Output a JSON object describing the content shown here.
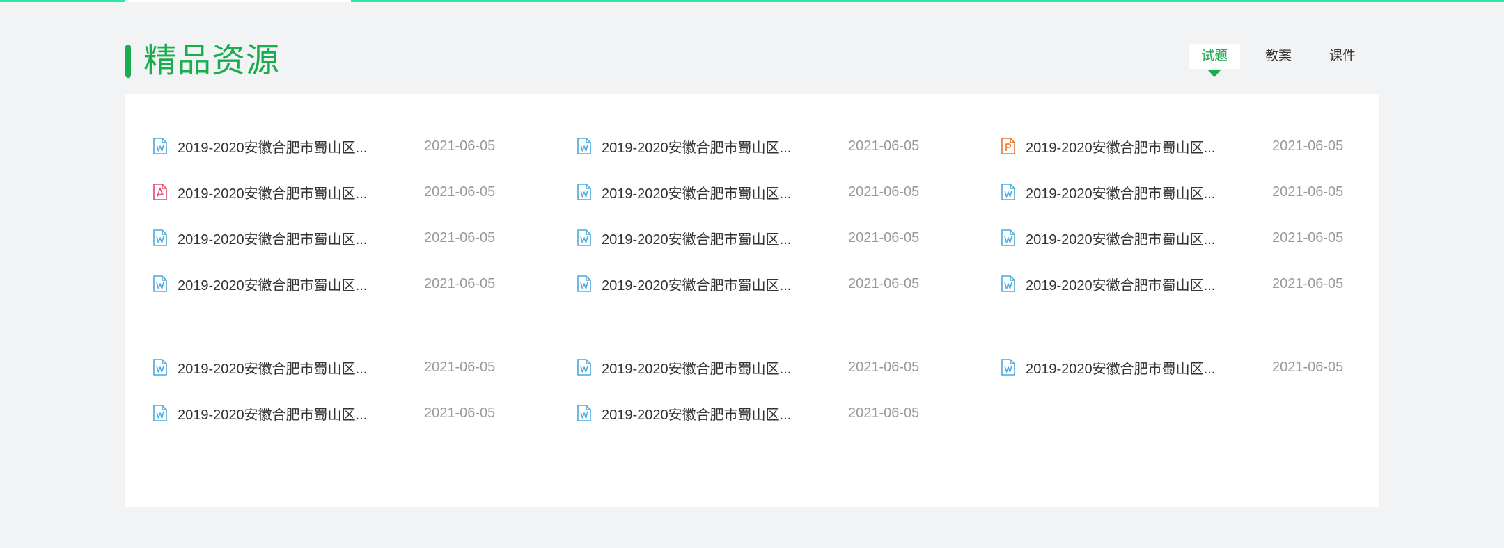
{
  "section": {
    "title": "精品资源"
  },
  "tabs": [
    {
      "label": "试题",
      "active": true
    },
    {
      "label": "教案",
      "active": false
    },
    {
      "label": "课件",
      "active": false
    }
  ],
  "colors": {
    "brand_green": "#1aad4e",
    "top_bar": "#2ee6a5",
    "word_icon": "#4aa8dd",
    "pdf_icon": "#e8476a",
    "ppt_icon": "#e8772e"
  },
  "resources": {
    "group1": [
      {
        "title": "2019-2020安徽合肥市蜀山区...",
        "date": "2021-06-05",
        "icon": "word-file-icon"
      },
      {
        "title": "2019-2020安徽合肥市蜀山区...",
        "date": "2021-06-05",
        "icon": "word-file-icon"
      },
      {
        "title": "2019-2020安徽合肥市蜀山区...",
        "date": "2021-06-05",
        "icon": "ppt-file-icon"
      },
      {
        "title": "2019-2020安徽合肥市蜀山区...",
        "date": "2021-06-05",
        "icon": "pdf-file-icon"
      },
      {
        "title": "2019-2020安徽合肥市蜀山区...",
        "date": "2021-06-05",
        "icon": "word-file-icon"
      },
      {
        "title": "2019-2020安徽合肥市蜀山区...",
        "date": "2021-06-05",
        "icon": "word-file-icon"
      },
      {
        "title": "2019-2020安徽合肥市蜀山区...",
        "date": "2021-06-05",
        "icon": "word-file-icon"
      },
      {
        "title": "2019-2020安徽合肥市蜀山区...",
        "date": "2021-06-05",
        "icon": "word-file-icon"
      },
      {
        "title": "2019-2020安徽合肥市蜀山区...",
        "date": "2021-06-05",
        "icon": "word-file-icon"
      },
      {
        "title": "2019-2020安徽合肥市蜀山区...",
        "date": "2021-06-05",
        "icon": "word-file-icon"
      },
      {
        "title": "2019-2020安徽合肥市蜀山区...",
        "date": "2021-06-05",
        "icon": "word-file-icon"
      },
      {
        "title": "2019-2020安徽合肥市蜀山区...",
        "date": "2021-06-05",
        "icon": "word-file-icon"
      }
    ],
    "group2": [
      {
        "title": "2019-2020安徽合肥市蜀山区...",
        "date": "2021-06-05",
        "icon": "word-file-icon"
      },
      {
        "title": "2019-2020安徽合肥市蜀山区...",
        "date": "2021-06-05",
        "icon": "word-file-icon"
      },
      {
        "title": "2019-2020安徽合肥市蜀山区...",
        "date": "2021-06-05",
        "icon": "word-file-icon"
      },
      {
        "title": "2019-2020安徽合肥市蜀山区...",
        "date": "2021-06-05",
        "icon": "word-file-icon"
      },
      {
        "title": "2019-2020安徽合肥市蜀山区...",
        "date": "2021-06-05",
        "icon": "word-file-icon"
      }
    ]
  }
}
